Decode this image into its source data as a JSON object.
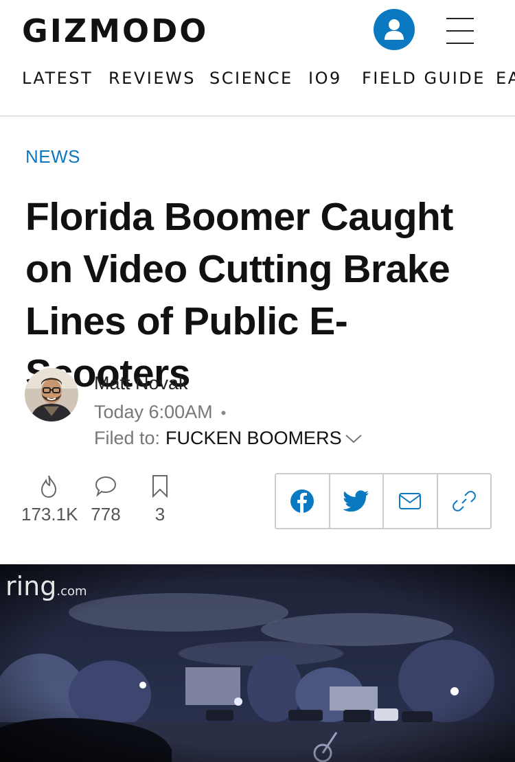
{
  "header": {
    "logo": "GIZMODO",
    "nav": [
      "LATEST",
      "REVIEWS",
      "SCIENCE",
      "IO9",
      "FIELD GUIDE",
      "EA"
    ],
    "accent_color": "#0b78c2"
  },
  "article": {
    "section": "NEWS",
    "headline": "Florida Boomer Caught on Video Cutting Brake Lines of Public E-Scooters",
    "author": "Matt Novak",
    "date": "Today 6:00AM",
    "filed_label": "Filed to:",
    "filed_tag": "FUCKEN BOOMERS"
  },
  "stats": {
    "views": "173.1K",
    "comments": "778",
    "bookmarks": "3"
  },
  "share": {
    "icons": [
      "facebook-icon",
      "twitter-icon",
      "email-icon",
      "link-icon"
    ]
  },
  "hero": {
    "watermark": "ring",
    "watermark_suffix": ".com"
  }
}
